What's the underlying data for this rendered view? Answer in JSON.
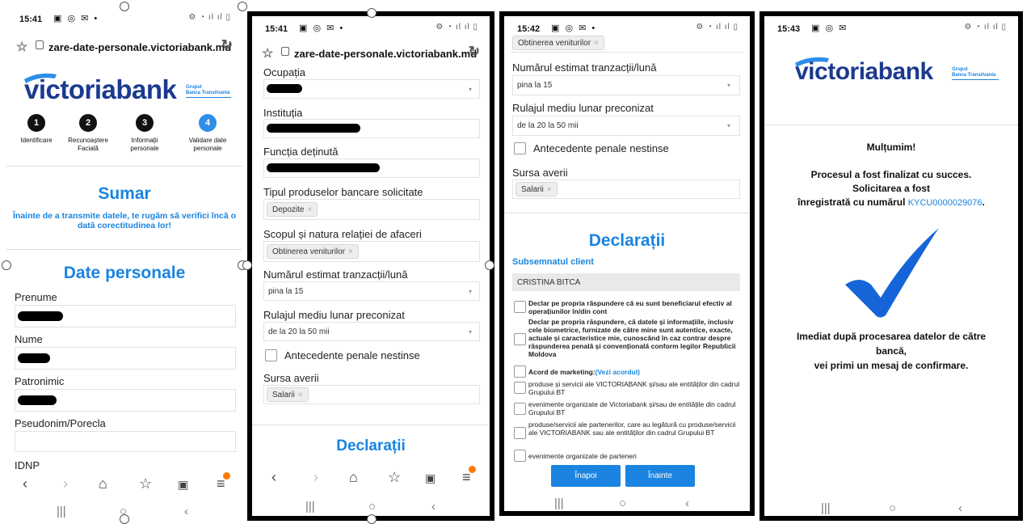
{
  "status": {
    "p1_time": "15:41",
    "p2_time": "15:41",
    "p3_time": "15:42",
    "p4_time": "15:43"
  },
  "browser": {
    "p1_url": "zare-date-personale.victoriabank.md",
    "p2_url": "zare-date-personale.victoriabank.md"
  },
  "brand": {
    "logo_text": "victoriabank",
    "group_line1": "Grupul",
    "group_line2": "Banca Transilvania",
    "color_primary": "#1a84e0",
    "color_logo": "#1b3a8f"
  },
  "steps": [
    {
      "num": "1",
      "label": "Identificare"
    },
    {
      "num": "2",
      "label": "Recunoaștere Facială"
    },
    {
      "num": "3",
      "label": "Informații personale"
    },
    {
      "num": "4",
      "label": "Validare date personale"
    }
  ],
  "summary": {
    "title": "Sumar",
    "subtitle": "Înainte de a transmite datele, te rugăm să verifici încă o dată corectitudinea lor!",
    "personal_heading": "Date personale",
    "fields": {
      "prenume": "Prenume",
      "nume": "Nume",
      "patronimic": "Patronimic",
      "pseudonim": "Pseudonim/Porecla",
      "idnp": "IDNP"
    }
  },
  "form": {
    "ocupatia": "Ocupația",
    "institutia": "Instituția",
    "functia": "Funcția deținută",
    "produse_label": "Tipul produselor bancare solicitate",
    "produse_tag": "Depozite",
    "scopul_label": "Scopul și natura relației de afaceri",
    "scopul_tag": "Obtinerea veniturilor",
    "tranzactii_label": "Numărul estimat tranzacții/lună",
    "tranzactii_value": "pina la 15",
    "rulaj_label": "Rulajul mediu lunar preconizat",
    "rulaj_value": "de la 20 la 50 mii",
    "antecedente": "Antecedente penale nestinse",
    "sursa_label": "Sursa averii",
    "sursa_tag": "Salarii",
    "tag_remove": "×",
    "declaratii_heading": "Declarații"
  },
  "declarations": {
    "subsemnatul": "Subsemnatul client",
    "client_name": "CRISTINA BITCA",
    "items": [
      "Declar pe propria răspundere că eu sunt beneficiarul efectiv al operațiunilor în/din cont",
      "Declar pe propria răspundere, că datele și informațiile, inclusiv cele biometrice, furnizate de către mine sunt autentice, exacte, actuale și caracteristice mie, cunoscând în caz contrar despre răspunderea penală și convențională conform legilor Republicii Moldova",
      "Acord de marketing:",
      "produse și servicii ale VICTORIABANK și/sau ale entităților din cadrul Grupului BT",
      "evenimente organizate de Victoriabank și/sau de entitățile din cadrul Grupului BT",
      "produse/servicii ale partenerilor, care au legătură cu produse/servicii ale VICTORIABANK sau ale entităților din cadrul Grupului BT",
      "evenimente organizate de parteneri"
    ],
    "marketing_link": "(Vezi acordul)",
    "back_button": "Înapoi",
    "next_button": "Înainte"
  },
  "success": {
    "thanks": "Mulțumim!",
    "line1": "Procesul a fost finalizat cu succes.",
    "line2": "Solicitarea a fost",
    "line3_prefix": "înregistrată cu numărul ",
    "ticket": "KYCU0000029076",
    "line3_suffix": ".",
    "note1": "Imediat după procesarea datelor de către",
    "note2": "bancă,",
    "note3": "vei primi un mesaj de confirmare."
  },
  "icons": {
    "nav": [
      "back-icon",
      "forward-icon",
      "home-icon",
      "bookmark-icon",
      "tabs-icon",
      "menu-icon"
    ],
    "sys": [
      "recents-icon",
      "home-circle-icon",
      "back-chevron-icon"
    ]
  }
}
